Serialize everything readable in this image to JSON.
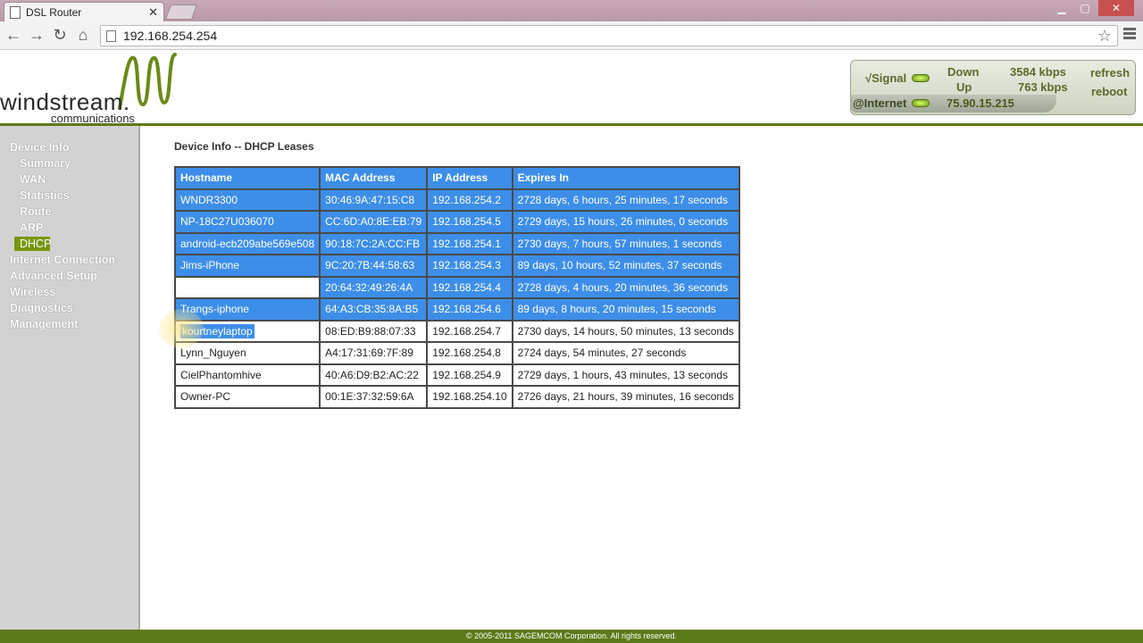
{
  "browser": {
    "tab_title": "DSL Router",
    "tab_close": "✕",
    "url": "192.168.254.254"
  },
  "logo": {
    "main": "windstream.",
    "sub": "communications"
  },
  "status": {
    "signal_label": "√Signal",
    "down_label": "Down",
    "up_label": "Up",
    "down_value": "3584 kbps",
    "up_value": "763 kbps",
    "refresh_label": "refresh",
    "reboot_label": "reboot",
    "internet_label": "@Internet",
    "ip_address": "75.90.15.215",
    "led_color": "#8fce1a"
  },
  "sidebar": {
    "items": [
      {
        "label": "Device Info"
      },
      {
        "label": "Summary"
      },
      {
        "label": "WAN"
      },
      {
        "label": "Statistics"
      },
      {
        "label": "Route"
      },
      {
        "label": "ARP"
      },
      {
        "label": "DHCP"
      },
      {
        "label": "Internet Connection"
      },
      {
        "label": "Advanced Setup"
      },
      {
        "label": "Wireless"
      },
      {
        "label": "Diagnostics"
      },
      {
        "label": "Management"
      }
    ],
    "active": "DHCP"
  },
  "main": {
    "title": "Device Info -- DHCP Leases",
    "columns": [
      "Hostname",
      "MAC Address",
      "IP Address",
      "Expires In"
    ],
    "rows": [
      {
        "hostname": "WNDR3300",
        "mac": "30:46:9A:47:15:C8",
        "ip": "192.168.254.2",
        "expires": "2728 days, 6 hours, 25 minutes, 17 seconds"
      },
      {
        "hostname": "NP-18C27U036070",
        "mac": "CC:6D:A0:8E:EB:79",
        "ip": "192.168.254.5",
        "expires": "2729 days, 15 hours, 26 minutes, 0 seconds"
      },
      {
        "hostname": "android-ecb209abe569e508",
        "mac": "90:18:7C:2A:CC:FB",
        "ip": "192.168.254.1",
        "expires": "2730 days, 7 hours, 57 minutes, 1 seconds"
      },
      {
        "hostname": "Jims-iPhone",
        "mac": "9C:20:7B:44:58:63",
        "ip": "192.168.254.3",
        "expires": "89 days, 10 hours, 52 minutes, 37 seconds"
      },
      {
        "hostname": "",
        "mac": "20:64:32:49:26:4A",
        "ip": "192.168.254.4",
        "expires": "2728 days, 4 hours, 20 minutes, 36 seconds"
      },
      {
        "hostname": "Trangs-iphone",
        "mac": "64:A3:CB:35:8A:B5",
        "ip": "192.168.254.6",
        "expires": "89 days, 8 hours, 20 minutes, 15 seconds"
      },
      {
        "hostname": "kourtneylaptop",
        "mac": "08:ED:B9:88:07:33",
        "ip": "192.168.254.7",
        "expires": "2730 days, 14 hours, 50 minutes, 13 seconds"
      },
      {
        "hostname": "Lynn_Nguyen",
        "mac": "A4:17:31:69:7F:89",
        "ip": "192.168.254.8",
        "expires": "2724 days, 54 minutes, 27 seconds"
      },
      {
        "hostname": "CielPhantomhive",
        "mac": "40:A6:D9:B2:AC:22",
        "ip": "192.168.254.9",
        "expires": "2729 days, 1 hours, 43 minutes, 13 seconds"
      },
      {
        "hostname": "Owner-PC",
        "mac": "00:1E:37:32:59:6A",
        "ip": "192.168.254.10",
        "expires": "2726 days, 21 hours, 39 minutes, 16 seconds"
      }
    ]
  },
  "footer": {
    "copyright": "© 2005-2011 SAGEMCOM Corporation. All rights reserved."
  }
}
